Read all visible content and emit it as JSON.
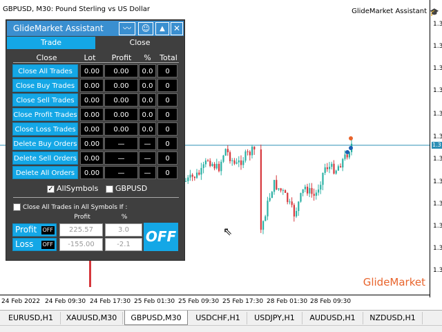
{
  "chart": {
    "title": "GBPUSD, M30:  Pound Sterling vs US Dollar",
    "ea_label": "GlideMarket Assistant",
    "ea_icon": "graduation-cap-icon",
    "watermark": "GlideMarket",
    "price_labels": [
      "1.3",
      "1.3",
      "1.3",
      "1.3",
      "1.3",
      "1.3",
      "1.3",
      "1.3",
      "1.3",
      "1.3",
      "1.3",
      "1.3",
      "1.3"
    ],
    "current_price_tag": "1.3",
    "time_labels": [
      "24 Feb 2022",
      "24 Feb 09:30",
      "24 Feb 17:30",
      "25 Feb 01:30",
      "25 Feb 09:30",
      "25 Feb 17:30",
      "28 Feb 01:30",
      "28 Feb 09:30"
    ],
    "colors": {
      "bull": "#2ab0a4",
      "bear": "#d6373c",
      "price_line": "#2c8fb5"
    }
  },
  "symbol_tabs": [
    {
      "label": "EURUSD,H1",
      "active": false
    },
    {
      "label": "XAUUSD,M30",
      "active": false
    },
    {
      "label": "GBPUSD,M30",
      "active": true
    },
    {
      "label": "USDCHF,H1",
      "active": false
    },
    {
      "label": "USDJPY,H1",
      "active": false
    },
    {
      "label": "AUDUSD,H1",
      "active": false
    },
    {
      "label": "NZDUSD,H1",
      "active": false
    }
  ],
  "panel": {
    "title": "GlideMarket Assistant",
    "header_buttons": {
      "chart": "〰",
      "smiley": "☺",
      "minimize": "▲",
      "close": "✕"
    },
    "tabs": {
      "trade": "Trade",
      "close": "Close",
      "active": "trade"
    },
    "columns": {
      "close": "Close",
      "lot": "Lot",
      "profit": "Profit",
      "pct": "%",
      "total": "Total"
    },
    "rows": [
      {
        "label": "Close All Trades",
        "lot": "0.00",
        "profit": "0.00",
        "pct": "0.0",
        "total": "0"
      },
      {
        "label": "Close Buy Trades",
        "lot": "0.00",
        "profit": "0.00",
        "pct": "0.0",
        "total": "0"
      },
      {
        "label": "Close Sell Trades",
        "lot": "0.00",
        "profit": "0.00",
        "pct": "0.0",
        "total": "0"
      },
      {
        "label": "Close Profit Trades",
        "lot": "0.00",
        "profit": "0.00",
        "pct": "0.0",
        "total": "0"
      },
      {
        "label": "Close Loss Trades",
        "lot": "0.00",
        "profit": "0.00",
        "pct": "0.0",
        "total": "0"
      },
      {
        "label": "Delete Buy Orders",
        "lot": "0.00",
        "profit": "—",
        "pct": "—",
        "total": "0"
      },
      {
        "label": "Delete Sell Orders",
        "lot": "0.00",
        "profit": "—",
        "pct": "—",
        "total": "0"
      },
      {
        "label": "Delete All Orders",
        "lot": "0.00",
        "profit": "—",
        "pct": "—",
        "total": "0"
      }
    ],
    "all_symbols": {
      "label": "AllSymbols",
      "checked": true
    },
    "current_symbol": {
      "label": "GBPUSD",
      "checked": false
    },
    "close_if": {
      "label": "Close All Trades in All Symbols If :",
      "checked": false
    },
    "close_if_headers": {
      "profit": "Profit",
      "pct": "%"
    },
    "profit_rule": {
      "label": "Profit",
      "state": "OFF",
      "amount": "225.57",
      "pct": "3.0"
    },
    "loss_rule": {
      "label": "Loss",
      "state": "OFF",
      "amount": "-155.00",
      "pct": "-2.1"
    },
    "master_switch": "OFF"
  }
}
